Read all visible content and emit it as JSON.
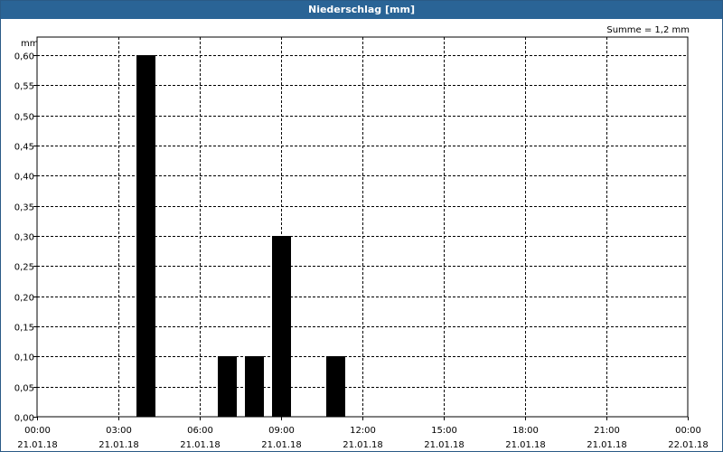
{
  "window": {
    "title": "Niederschlag [mm]"
  },
  "chart_data": {
    "type": "bar",
    "title": "Niederschlag [mm]",
    "subtitle": "Summe = 1,2 mm",
    "ylabel": "mm",
    "xlabel": "",
    "ylim": [
      0,
      0.6
    ],
    "y_ticks": [
      {
        "value": 0.0,
        "label": "0,00"
      },
      {
        "value": 0.05,
        "label": "0,05"
      },
      {
        "value": 0.1,
        "label": "0,10"
      },
      {
        "value": 0.15,
        "label": "0,15"
      },
      {
        "value": 0.2,
        "label": "0,20"
      },
      {
        "value": 0.25,
        "label": "0,25"
      },
      {
        "value": 0.3,
        "label": "0,30"
      },
      {
        "value": 0.35,
        "label": "0,35"
      },
      {
        "value": 0.4,
        "label": "0,40"
      },
      {
        "value": 0.45,
        "label": "0,45"
      },
      {
        "value": 0.5,
        "label": "0,50"
      },
      {
        "value": 0.55,
        "label": "0,55"
      },
      {
        "value": 0.6,
        "label": "0,60"
      }
    ],
    "xlim_hours": [
      0,
      24
    ],
    "x_ticks": [
      {
        "hour": 0,
        "time": "00:00",
        "date": "21.01.18"
      },
      {
        "hour": 3,
        "time": "03:00",
        "date": "21.01.18"
      },
      {
        "hour": 6,
        "time": "06:00",
        "date": "21.01.18"
      },
      {
        "hour": 9,
        "time": "09:00",
        "date": "21.01.18"
      },
      {
        "hour": 12,
        "time": "12:00",
        "date": "21.01.18"
      },
      {
        "hour": 15,
        "time": "15:00",
        "date": "21.01.18"
      },
      {
        "hour": 18,
        "time": "18:00",
        "date": "21.01.18"
      },
      {
        "hour": 21,
        "time": "21:00",
        "date": "21.01.18"
      },
      {
        "hour": 24,
        "time": "00:00",
        "date": "22.01.18"
      }
    ],
    "bars": [
      {
        "hour": 4,
        "value": 0.6
      },
      {
        "hour": 7,
        "value": 0.1
      },
      {
        "hour": 8,
        "value": 0.1
      },
      {
        "hour": 9,
        "value": 0.3
      },
      {
        "hour": 11,
        "value": 0.1
      }
    ],
    "grid": true,
    "colors": {
      "bar": "#000000",
      "grid": "#000000",
      "titlebar": "#2a6496"
    }
  }
}
